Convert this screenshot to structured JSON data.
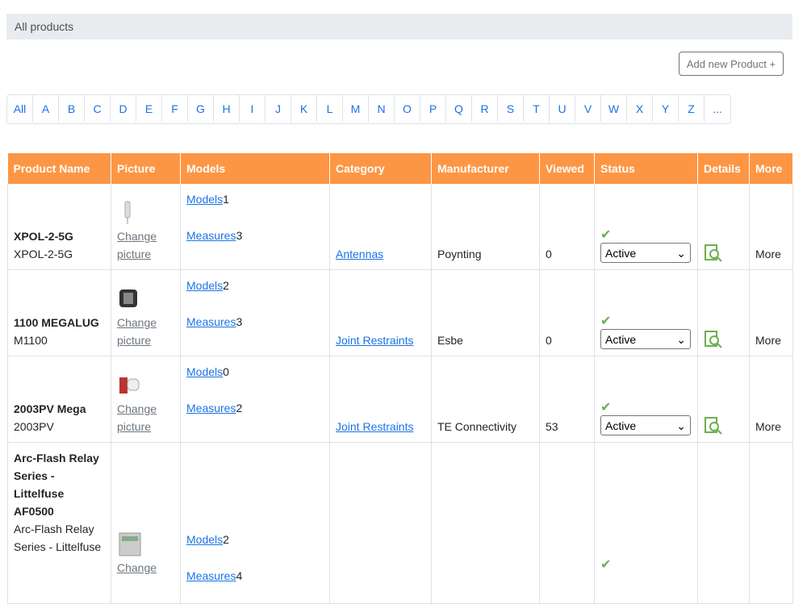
{
  "header": {
    "title": "All products"
  },
  "actions": {
    "add_label": "Add new Product +"
  },
  "alphabet": [
    "All",
    "A",
    "B",
    "C",
    "D",
    "E",
    "F",
    "G",
    "H",
    "I",
    "J",
    "K",
    "L",
    "M",
    "N",
    "O",
    "P",
    "Q",
    "R",
    "S",
    "T",
    "U",
    "V",
    "W",
    "X",
    "Y",
    "Z",
    "..."
  ],
  "table": {
    "columns": [
      "Product Name",
      "Picture",
      "Models",
      "Category",
      "Manufacturer",
      "Viewed",
      "Status",
      "Details",
      "More"
    ],
    "rows": [
      {
        "name": "XPOL-2-5G",
        "code": "XPOL-2-5G",
        "change": "Change",
        "picture": "picture",
        "models_label": "Models",
        "models_count": "1",
        "measures_label": "Measures",
        "measures_count": "3",
        "category": "Antennas",
        "manufacturer": "Poynting",
        "viewed": "0",
        "status": "Active",
        "more": "More"
      },
      {
        "name": "1100 MEGALUG",
        "code": "M1100",
        "change": "Change",
        "picture": "picture",
        "models_label": "Models",
        "models_count": "2",
        "measures_label": "Measures",
        "measures_count": "3",
        "category": "Joint Restraints",
        "manufacturer": "Esbe",
        "viewed": "0",
        "status": "Active",
        "more": "More"
      },
      {
        "name": "2003PV Mega",
        "code": "2003PV",
        "change": "Change",
        "picture": "picture",
        "models_label": "Models",
        "models_count": "0",
        "measures_label": "Measures",
        "measures_count": "2",
        "category": "Joint Restraints",
        "manufacturer": "TE Connectivity",
        "viewed": "53",
        "status": "Active",
        "more": "More"
      },
      {
        "name": "Arc-Flash Relay Series - Littelfuse AF0500",
        "code": "Arc-Flash Relay Series - Littelfuse",
        "change": "Change",
        "models_label": "Models",
        "models_count": "2",
        "measures_label": "Measures",
        "measures_count": "4"
      }
    ]
  },
  "colors": {
    "header_bg": "#fd9644",
    "link": "#1a73e8",
    "check": "#6ab04c"
  },
  "icons": {
    "status_ok": "checkmark-icon",
    "details": "search-document-icon"
  }
}
